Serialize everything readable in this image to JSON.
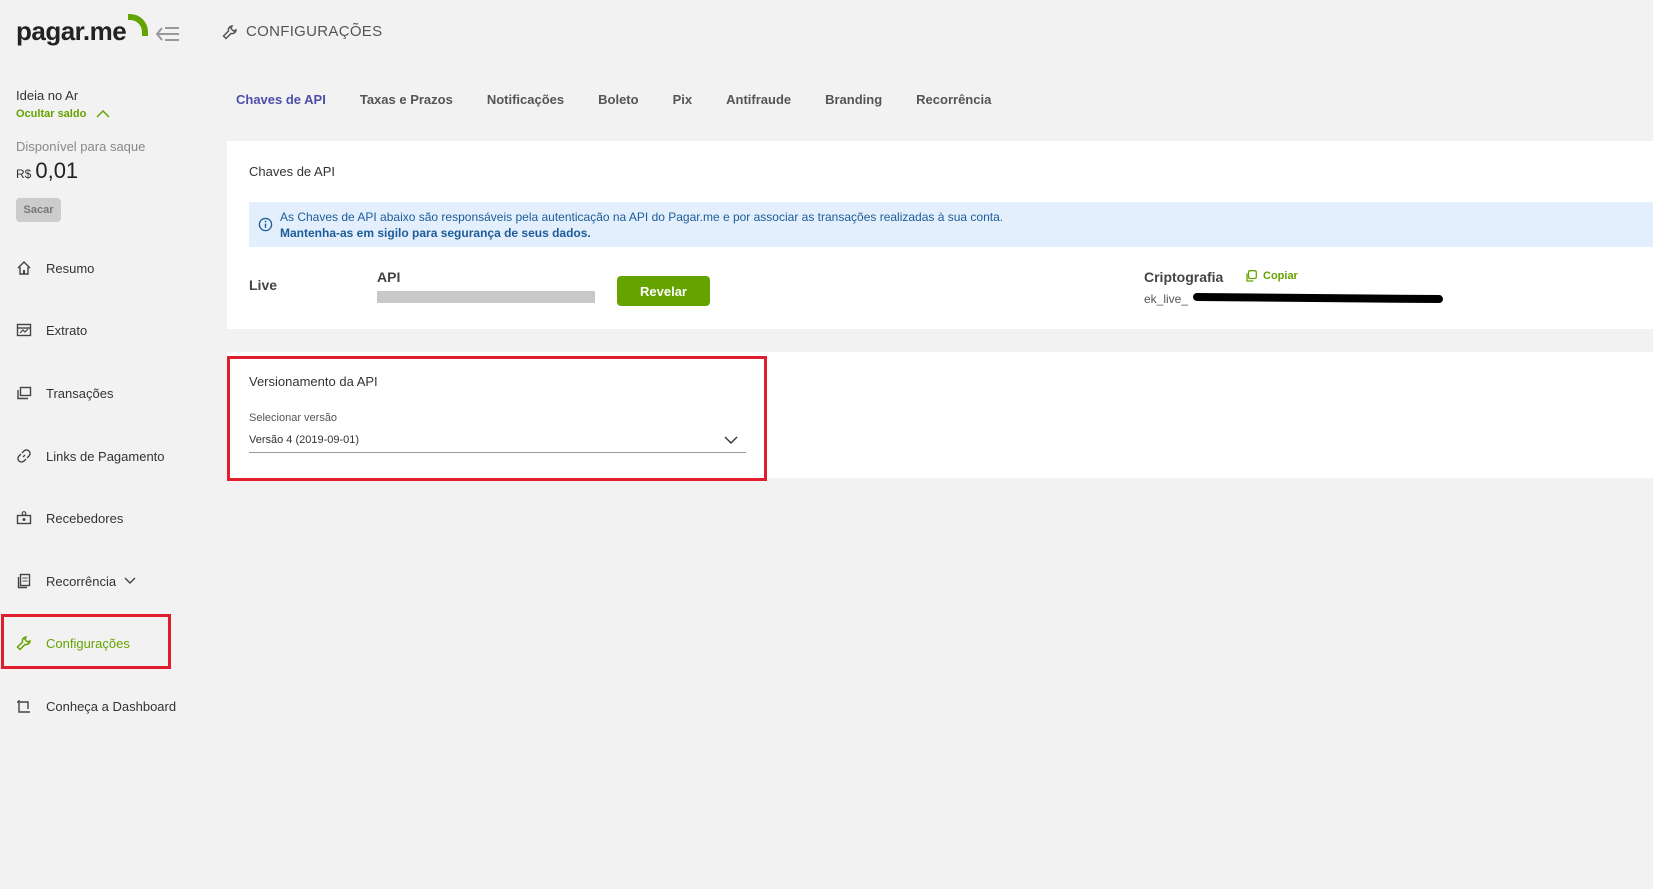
{
  "brand": {
    "logo_text": "pagar.me",
    "accent": "#65a300"
  },
  "sidebar": {
    "account_name": "Ideia no Ar",
    "hide_balance_label": "Ocultar saldo",
    "available_label": "Disponível para saque",
    "currency": "R$",
    "balance": "0,01",
    "withdraw_label": "Sacar",
    "items": [
      {
        "label": "Resumo",
        "icon": "home-icon"
      },
      {
        "label": "Extrato",
        "icon": "statement-icon"
      },
      {
        "label": "Transações",
        "icon": "transactions-icon"
      },
      {
        "label": "Links de Pagamento",
        "icon": "link-icon"
      },
      {
        "label": "Recebedores",
        "icon": "recipients-icon"
      },
      {
        "label": "Recorrência",
        "icon": "recurrence-icon"
      },
      {
        "label": "Configurações",
        "icon": "wrench-icon"
      },
      {
        "label": "Conheça a Dashboard",
        "icon": "dashboard-tour-icon"
      }
    ]
  },
  "header": {
    "title": "CONFIGURAÇÕES"
  },
  "tabs": [
    "Chaves de API",
    "Taxas e Prazos",
    "Notificações",
    "Boleto",
    "Pix",
    "Antifraude",
    "Branding",
    "Recorrência"
  ],
  "api_keys": {
    "title": "Chaves de API",
    "info_text": "As Chaves de API abaixo são responsáveis pela autenticação na API do Pagar.me e por associar as transações realizadas à sua conta.",
    "info_bold": "Mantenha-as em sigilo para segurança de seus dados.",
    "env_label": "Live",
    "api_label": "API",
    "reveal_label": "Revelar",
    "crypto_label": "Criptografia",
    "copy_label": "Copiar",
    "crypto_key_prefix": "ek_live_"
  },
  "versioning": {
    "title": "Versionamento da API",
    "select_label": "Selecionar versão",
    "selected_value": "Versão 4 (2019-09-01)"
  }
}
